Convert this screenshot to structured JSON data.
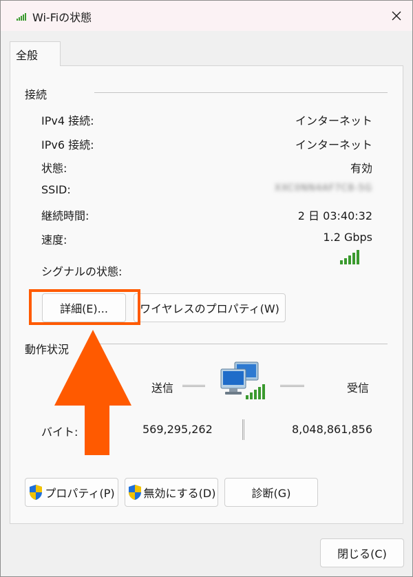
{
  "window": {
    "title": "Wi-Fiの状態",
    "close_glyph": "✕"
  },
  "tabs": [
    {
      "label": "全般"
    }
  ],
  "connection": {
    "section_title": "接続",
    "rows": [
      {
        "label": "IPv4 接続:",
        "value": "インターネット"
      },
      {
        "label": "IPv6 接続:",
        "value": "インターネット"
      },
      {
        "label": "状態:",
        "value": "有効"
      },
      {
        "label": "SSID:",
        "value": "XXC0NN4AF7C8-5G"
      },
      {
        "label": "継続時間:",
        "value": "2 日 03:40:32"
      },
      {
        "label": "速度:",
        "value": "1.2 Gbps"
      }
    ],
    "signal_label": "シグナルの状態:",
    "signal_bars": 5,
    "details_button": "詳細(E)...",
    "wireless_button": "ワイヤレスのプロパティ(W)"
  },
  "activity": {
    "section_title": "動作状況",
    "sent_label": "送信",
    "received_label": "受信",
    "bytes_label": "バイト:",
    "sent_bytes": "569,295,262",
    "received_bytes": "8,048,861,856"
  },
  "buttons": {
    "properties": "プロパティ(P)",
    "disable": "無効にする(D)",
    "diagnose": "診断(G)",
    "close": "閉じる(C)"
  },
  "colors": {
    "highlight": "#ff5a00",
    "signal": "#3a9a2e",
    "shield_blue": "#1e6fd9",
    "shield_yellow": "#f2c200"
  },
  "icons": [
    "wifi-signal-icon",
    "close-icon",
    "network-computers-icon",
    "uac-shield-icon",
    "annotation-arrow"
  ]
}
